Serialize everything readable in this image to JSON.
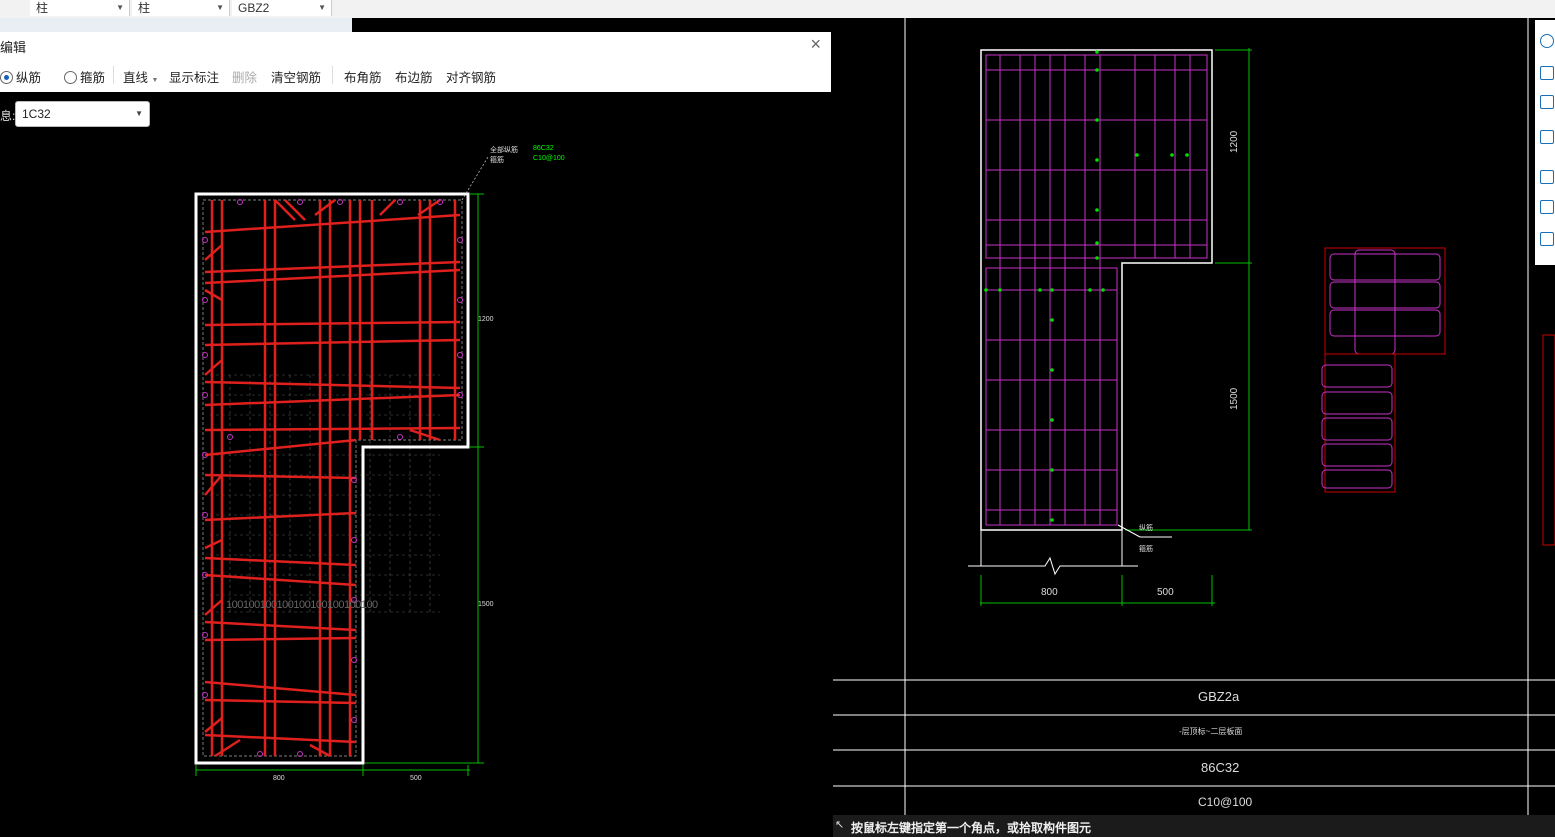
{
  "top_combos": [
    "柱",
    "柱",
    "GBZ2"
  ],
  "dialog": {
    "title": "编辑",
    "close": "×",
    "toolbar": {
      "radio_longitudinal": "纵筋",
      "radio_stirrup": "箍筋",
      "line_mode": "直线",
      "show_label": "显示标注",
      "delete": "删除",
      "clear_rebar": "清空钢筋",
      "corner_rebar": "布角筋",
      "edge_rebar": "布边筋",
      "align_rebar": "对齐钢筋"
    },
    "info_label": "息:",
    "rebar_select": "1C32"
  },
  "left_drawing": {
    "leader_labels": [
      "全部纵筋",
      "箍筋"
    ],
    "leader_values": [
      "86C32",
      "C10@100"
    ],
    "dims": {
      "d1200": "1200",
      "d1500": "1500",
      "d800": "800",
      "d500": "500"
    },
    "grid_text": "100100100100100100100100100"
  },
  "right_drawing": {
    "dims": {
      "d1200": "1200",
      "d1500": "1500",
      "d800": "800",
      "d500": "500"
    },
    "leader": [
      "纵筋",
      "箍筋"
    ],
    "table": {
      "name": "GBZ2a",
      "elevation": "-层顶标~二层板面",
      "longitudinal": "86C32",
      "stirrup": "C10@100"
    }
  },
  "status": {
    "text": "按鼠标左键指定第一个角点，或拾取构件图元",
    "cursor": "↖"
  },
  "colors": {
    "rebar": "#e0201c",
    "stirrup": "#c832c8",
    "dim": "#00c000",
    "outline": "#ffffff"
  }
}
